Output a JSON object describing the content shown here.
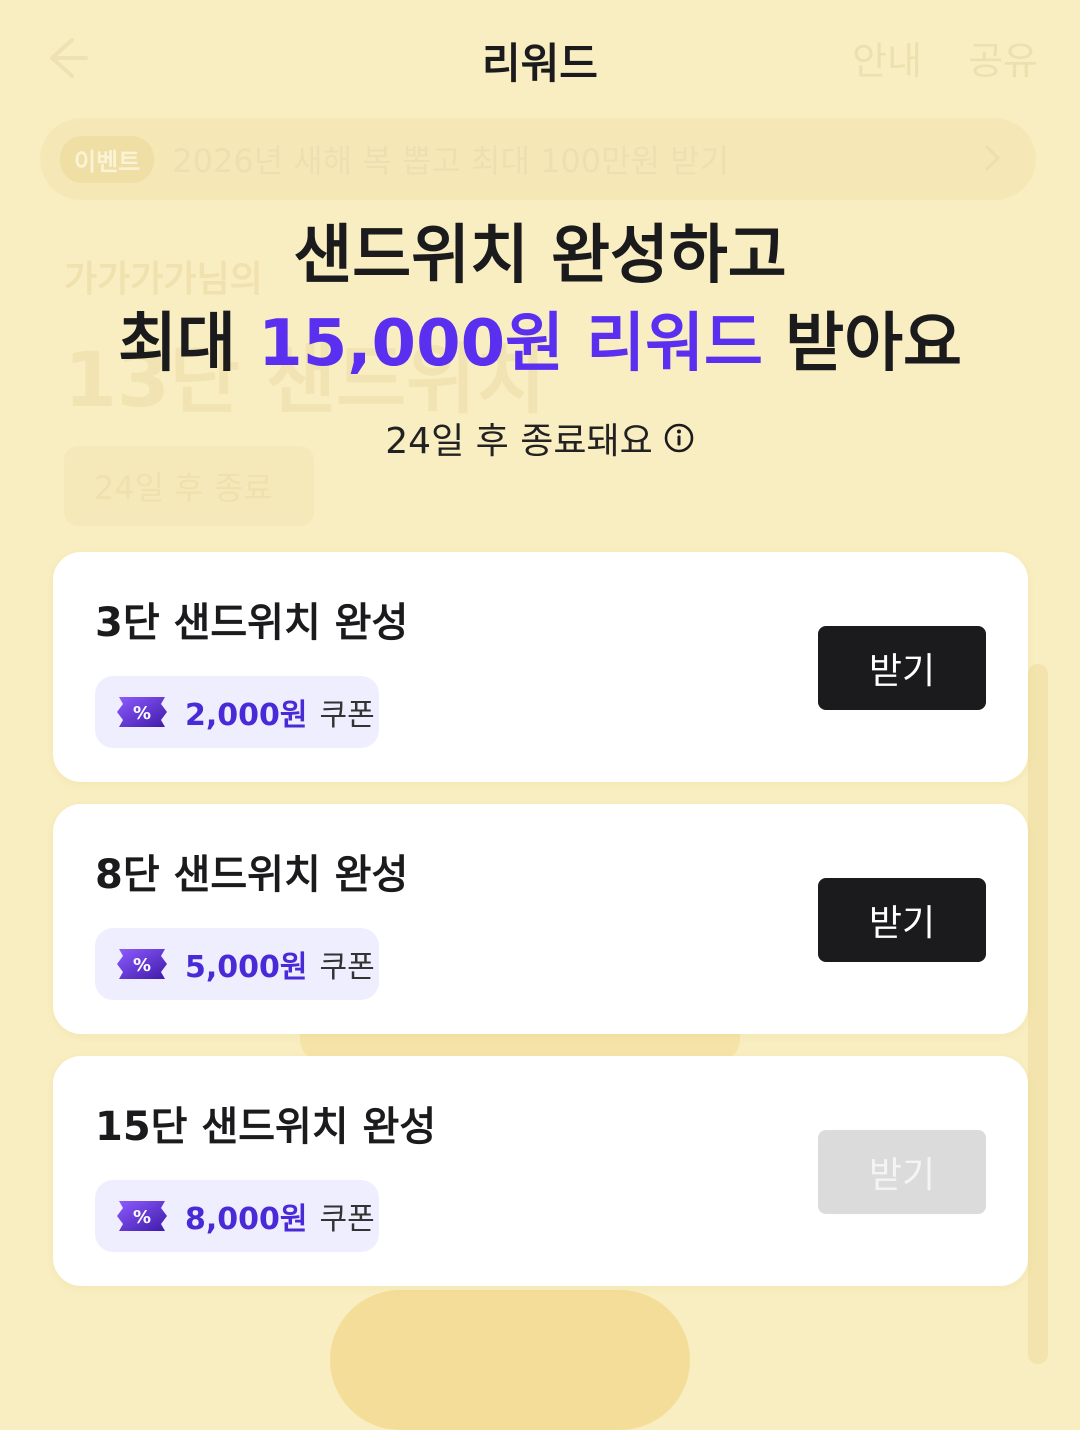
{
  "background": {
    "nav_right": [
      "안내",
      "공유"
    ],
    "event_badge": "이벤트",
    "event_text": "2026년 새해 복 뽑고 최대 100만원 받기",
    "nickname": "가가가가님의",
    "stage_text": "13단 샌드위치",
    "remaining_chip": "24일 후 종료"
  },
  "header": {
    "title": "리워드"
  },
  "hero": {
    "line1": "샌드위치 완성하고",
    "line2_prefix": "최대 ",
    "line2_accent": "15,000원 리워드",
    "line2_suffix": " 받아요",
    "ends_in": "24일 후 종료돼요"
  },
  "rewards": [
    {
      "title": "3단 샌드위치 완성",
      "amount": "2,000원",
      "unit": "쿠폰",
      "button": "받기",
      "enabled": true
    },
    {
      "title": "8단 샌드위치 완성",
      "amount": "5,000원",
      "unit": "쿠폰",
      "button": "받기",
      "enabled": true
    },
    {
      "title": "15단 샌드위치 완성",
      "amount": "8,000원",
      "unit": "쿠폰",
      "button": "받기",
      "enabled": false
    }
  ],
  "colors": {
    "accent": "#5b2ff0",
    "background": "#f9eec1",
    "button": "#1b1b1d",
    "button_disabled": "#dcdbdb"
  },
  "icons": {
    "back": "arrow-left-icon",
    "info": "info-circle-icon",
    "coupon": "percent-ticket-icon",
    "chevron": "chevron-right-icon"
  }
}
